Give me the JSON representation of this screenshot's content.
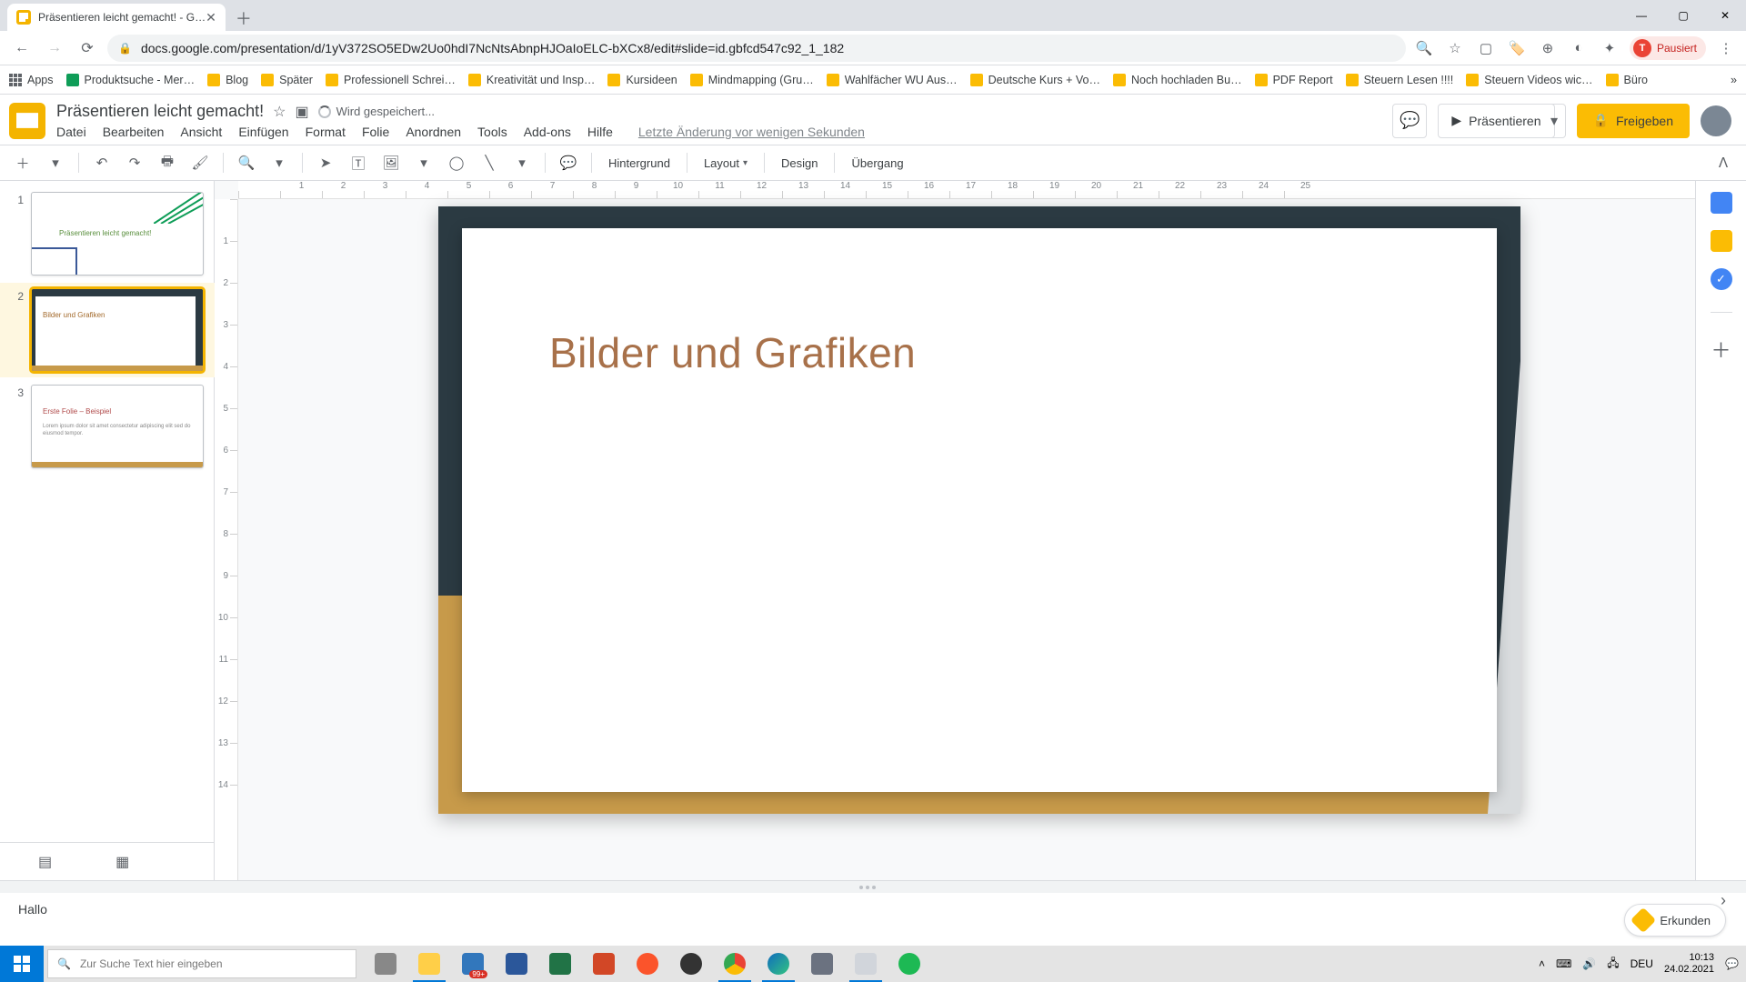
{
  "browser": {
    "tab_title": "Präsentieren leicht gemacht! - G…",
    "url": "docs.google.com/presentation/d/1yV372SO5EDw2Uo0hdI7NcNtsAbnpHJOaIoELC-bXCx8/edit#slide=id.gbfcd547c92_1_182",
    "profile_status": "Pausiert",
    "profile_initial": "T"
  },
  "bookmarks": {
    "apps": "Apps",
    "items": [
      "Produktsuche - Mer…",
      "Blog",
      "Später",
      "Professionell Schrei…",
      "Kreativität und Insp…",
      "Kursideen",
      "Mindmapping  (Gru…",
      "Wahlfächer WU Aus…",
      "Deutsche Kurs + Vo…",
      "Noch hochladen Bu…",
      "PDF Report",
      "Steuern Lesen !!!!",
      "Steuern Videos wic…",
      "Büro"
    ]
  },
  "doc": {
    "title": "Präsentieren leicht gemacht!",
    "saving": "Wird gespeichert...",
    "history": "Letzte Änderung vor wenigen Sekunden"
  },
  "menus": [
    "Datei",
    "Bearbeiten",
    "Ansicht",
    "Einfügen",
    "Format",
    "Folie",
    "Anordnen",
    "Tools",
    "Add-ons",
    "Hilfe"
  ],
  "header_btns": {
    "present": "Präsentieren",
    "share": "Freigeben"
  },
  "toolbar": {
    "background": "Hintergrund",
    "layout": "Layout",
    "design": "Design",
    "transition": "Übergang"
  },
  "slides": [
    {
      "n": "1",
      "title": "Präsentieren leicht gemacht!"
    },
    {
      "n": "2",
      "title": "Bilder und Grafiken"
    },
    {
      "n": "3",
      "title": "Erste Folie – Beispiel",
      "body": "Lorem ipsum dolor sit amet consectetur adipiscing elit sed do eiusmod tempor."
    }
  ],
  "current_slide": {
    "title": "Bilder und Grafiken"
  },
  "notes": {
    "text": "Hallo"
  },
  "explore": "Erkunden",
  "ruler_h": [
    "",
    "1",
    "2",
    "3",
    "4",
    "5",
    "6",
    "7",
    "8",
    "9",
    "10",
    "11",
    "12",
    "13",
    "14",
    "15",
    "16",
    "17",
    "18",
    "19",
    "20",
    "21",
    "22",
    "23",
    "24",
    "25"
  ],
  "ruler_v": [
    "",
    "1",
    "2",
    "3",
    "4",
    "5",
    "6",
    "7",
    "8",
    "9",
    "10",
    "11",
    "12",
    "13",
    "14"
  ],
  "taskbar": {
    "search_placeholder": "Zur Suche Text hier eingeben",
    "lang": "DEU",
    "time": "10:13",
    "date": "24.02.2021",
    "edge_badge": "99+"
  }
}
